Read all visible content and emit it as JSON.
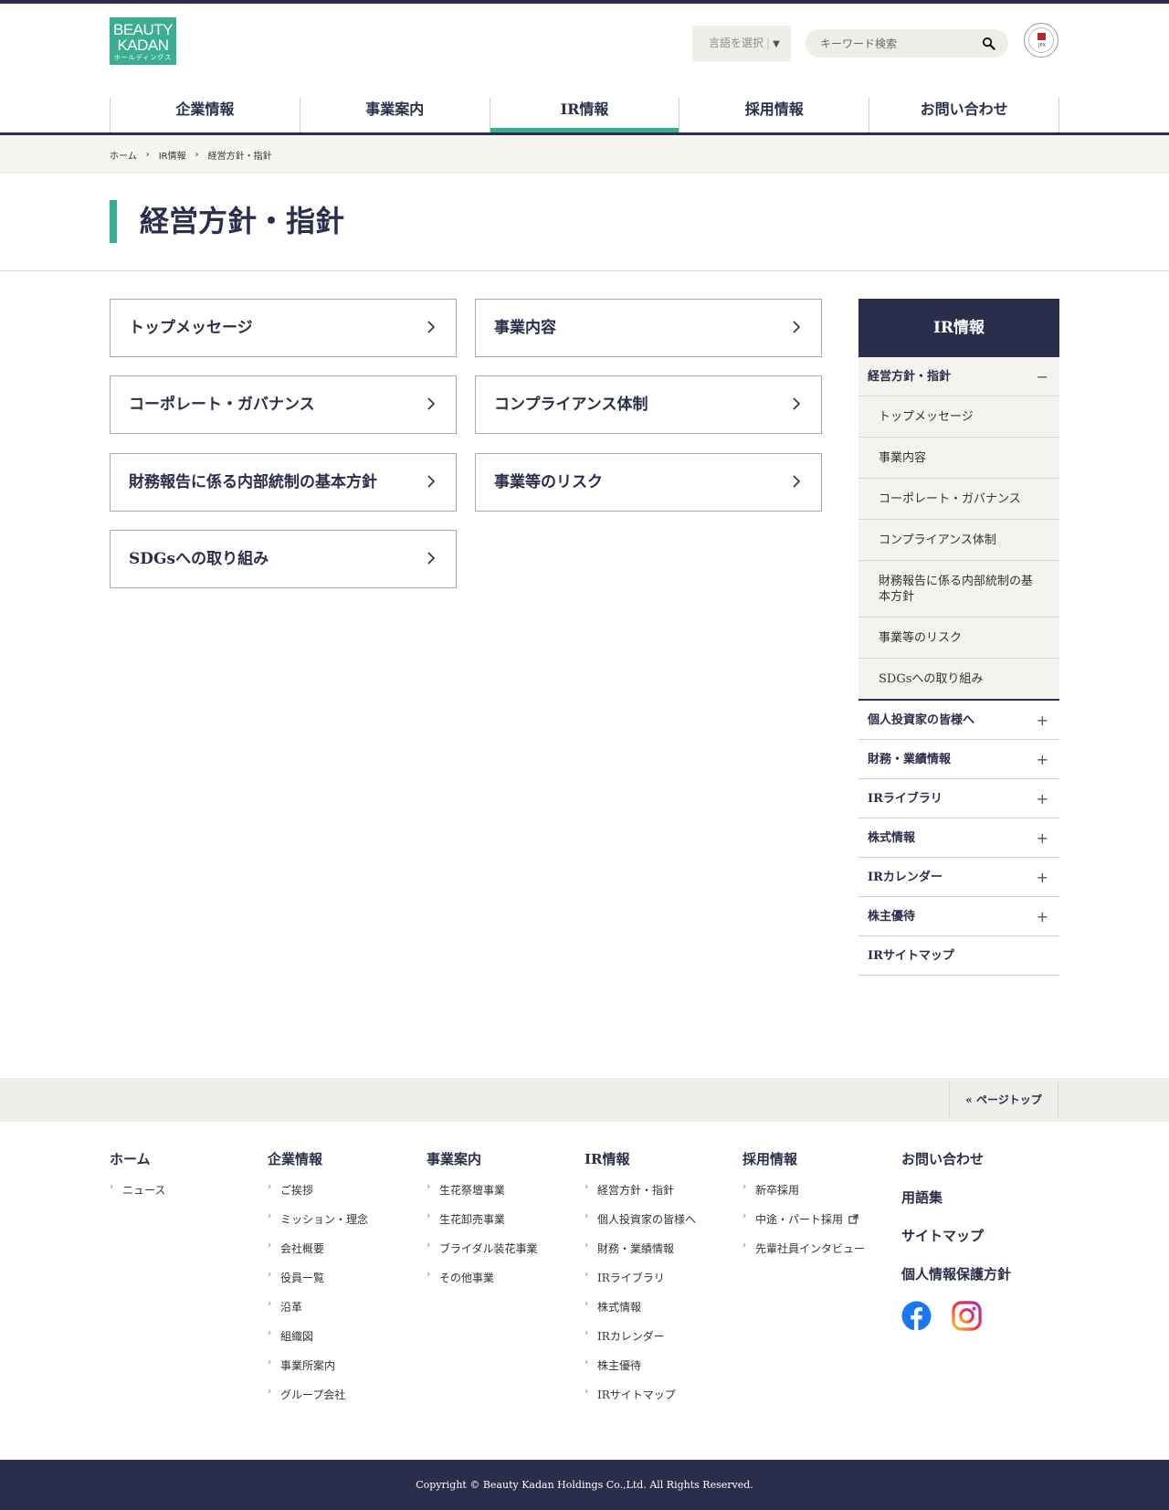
{
  "header": {
    "logo": {
      "line1": "BEAUTY",
      "line2": "KADAN",
      "line3": "ホールディングス"
    },
    "language_label": "言語を選択",
    "search_placeholder": "キーワード検索",
    "emblem_text": "JPX"
  },
  "nav": [
    "企業情報",
    "事業案内",
    "IR情報",
    "採用情報",
    "お問い合わせ"
  ],
  "breadcrumb": [
    "ホーム",
    "IR情報",
    "経営方針・指針"
  ],
  "page_title": "経営方針・指針",
  "cards": [
    "トップメッセージ",
    "事業内容",
    "コーポレート・ガバナンス",
    "コンプライアンス体制",
    "財務報告に係る内部統制の基本方針",
    "事業等のリスク",
    "SDGsへの取り組み"
  ],
  "sidebar": {
    "title": "IR情報",
    "current": "経営方針・指針",
    "sub_items": [
      "トップメッセージ",
      "事業内容",
      "コーポレート・ガバナンス",
      "コンプライアンス体制",
      "財務報告に係る内部統制の基本方針",
      "事業等のリスク",
      "SDGsへの取り組み"
    ],
    "groups": [
      "個人投資家の皆様へ",
      "財務・業績情報",
      "IRライブラリ",
      "株式情報",
      "IRカレンダー",
      "株主優待",
      "IRサイトマップ"
    ]
  },
  "footer": {
    "page_top": "ページトップ",
    "columns": [
      {
        "title": "ホーム",
        "links": [
          "ニュース"
        ]
      },
      {
        "title": "企業情報",
        "links": [
          "ご挨拶",
          "ミッション・理念",
          "会社概要",
          "役員一覧",
          "沿革",
          "組織図",
          "事業所案内",
          "グループ会社"
        ]
      },
      {
        "title": "事業案内",
        "links": [
          "生花祭壇事業",
          "生花卸売事業",
          "ブライダル装花事業",
          "その他事業"
        ]
      },
      {
        "title": "IR情報",
        "links": [
          "経営方針・指針",
          "個人投資家の皆様へ",
          "財務・業績情報",
          "IRライブラリ",
          "株式情報",
          "IRカレンダー",
          "株主優待",
          "IRサイトマップ"
        ]
      },
      {
        "title": "採用情報",
        "links": [
          "新卒採用",
          "中途・パート採用",
          "先輩社員インタビュー"
        ]
      }
    ],
    "bold_links": [
      "お問い合わせ",
      "用語集",
      "サイトマップ",
      "個人情報保護方針"
    ],
    "copyright": "Copyright © Beauty Kadan Holdings Co.,Ltd. All Rights Reserved."
  },
  "colors": {
    "navy": "#2b2e4a",
    "accent": "#3aae90",
    "facebook": "#1877f2"
  },
  "icons": [
    "search-icon",
    "chevron-right-icon",
    "minus-icon",
    "plus-icon",
    "external-link-icon",
    "facebook-icon",
    "instagram-icon",
    "double-chevron-up-icon"
  ]
}
